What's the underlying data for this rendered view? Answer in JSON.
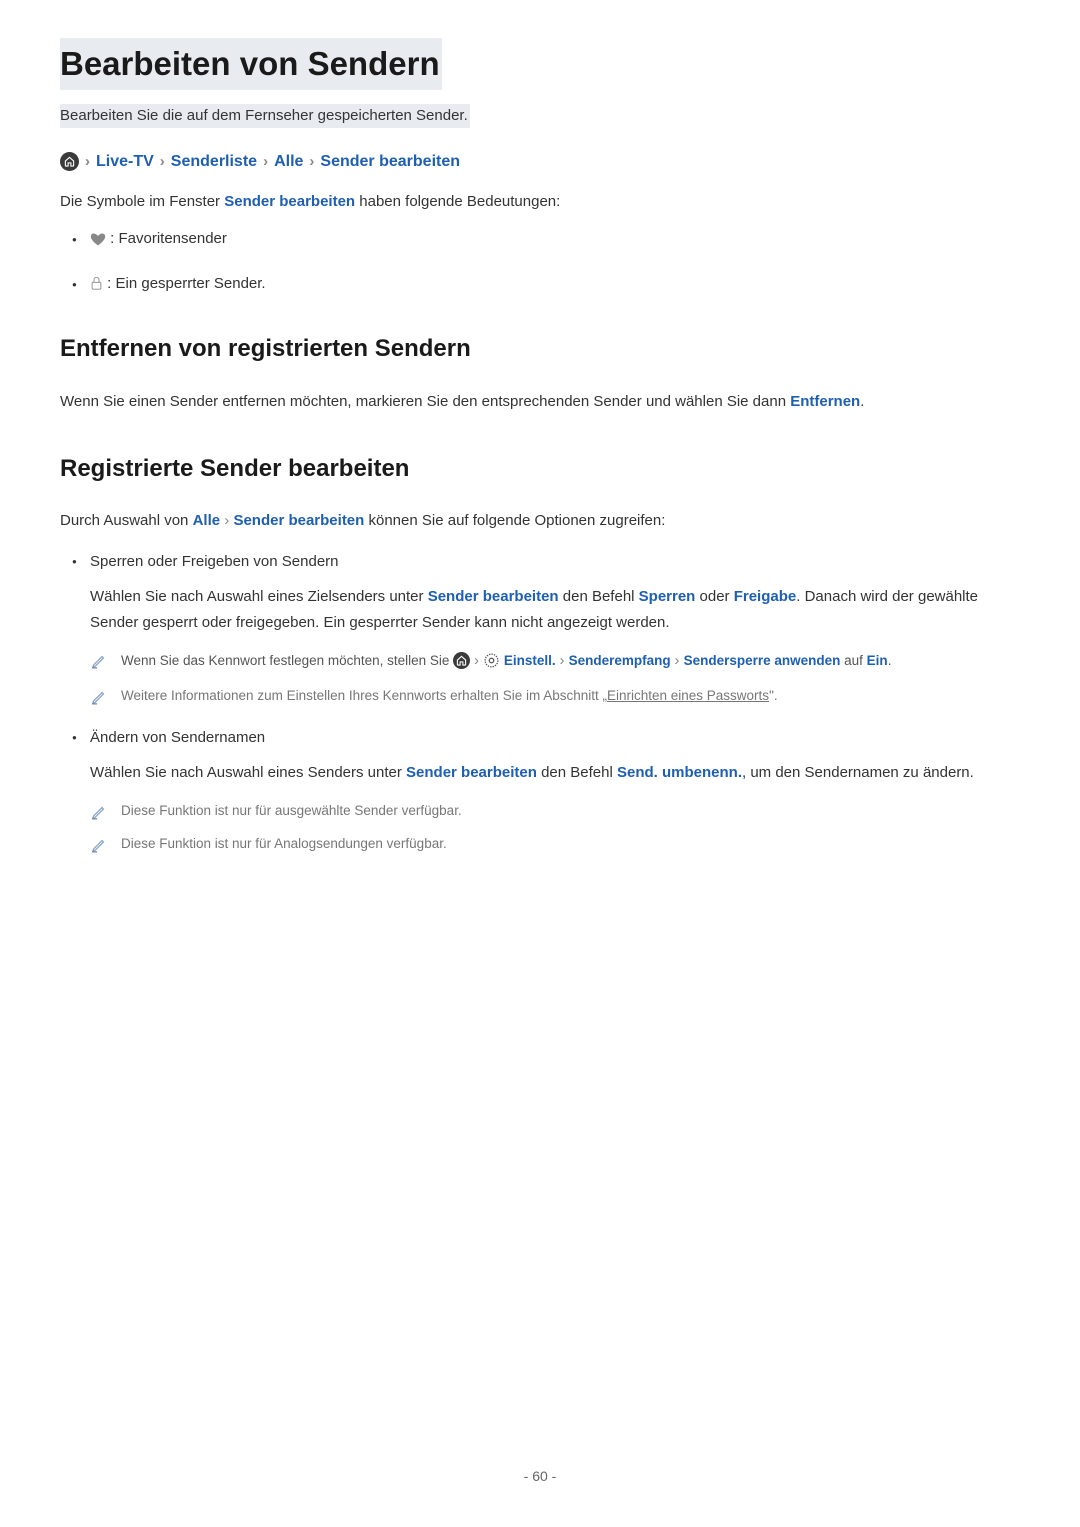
{
  "title": "Bearbeiten von Sendern",
  "subtitle": "Bearbeiten Sie die auf dem Fernseher gespeicherten Sender.",
  "breadcrumb": {
    "live_tv": "Live-TV",
    "senderliste": "Senderliste",
    "alle": "Alle",
    "sender_bearbeiten": "Sender bearbeiten"
  },
  "intro": {
    "prefix": "Die Symbole im Fenster ",
    "emph": "Sender bearbeiten",
    "suffix": " haben folgende Bedeutungen:"
  },
  "legend": {
    "heart": " : Favoritensender",
    "lock": " : Ein gesperrter Sender."
  },
  "section1": {
    "heading": "Entfernen von registrierten Sendern",
    "body": "Wenn Sie einen Sender entfernen möchten, markieren Sie den entsprechenden Sender und wählen Sie dann ",
    "action": "Entfernen",
    "period": "."
  },
  "section2": {
    "heading": "Registrierte Sender bearbeiten",
    "intro_prefix": "Durch Auswahl von ",
    "intro_alle": "Alle",
    "intro_sb": "Sender bearbeiten",
    "intro_suffix": " können Sie auf folgende Optionen zugreifen:"
  },
  "options": {
    "opt1": {
      "title": "Sperren oder Freigeben von Sendern",
      "body_prefix": "Wählen Sie nach Auswahl eines Zielsenders unter ",
      "sb": "Sender bearbeiten",
      "body_mid1": " den Befehl ",
      "sperren": "Sperren",
      "body_mid2": " oder ",
      "freigabe": "Freigabe",
      "body_suffix": ". Danach wird der gewählte Sender gesperrt oder freigegeben. Ein gesperrter Sender kann nicht angezeigt werden.",
      "note1_prefix": "Wenn Sie das Kennwort festlegen möchten, stellen Sie ",
      "note1_einstell": "Einstell.",
      "note1_senderempfang": "Senderempfang",
      "note1_sendersperre_anwenden": "Sendersperre anwenden",
      "note1_auf": " auf ",
      "note1_ein": "Ein",
      "note1_period": ".",
      "note2_prefix": "Weitere Informationen zum Einstellen Ihres Kennworts erhalten Sie im Abschnitt „",
      "note2_link": "Einrichten eines Passworts",
      "note2_suffix": "\"."
    },
    "opt2": {
      "title": "Ändern von Sendernamen",
      "body_prefix": "Wählen Sie nach Auswahl eines Senders unter ",
      "sb": "Sender bearbeiten",
      "body_mid": " den Befehl ",
      "umbenenn": "Send. umbenenn.",
      "body_suffix": ", um den Sendernamen zu ändern.",
      "note1": "Diese Funktion ist nur für ausgewählte Sender verfügbar.",
      "note2": "Diese Funktion ist nur für Analogsendungen verfügbar."
    }
  },
  "page_number": "- 60 -"
}
